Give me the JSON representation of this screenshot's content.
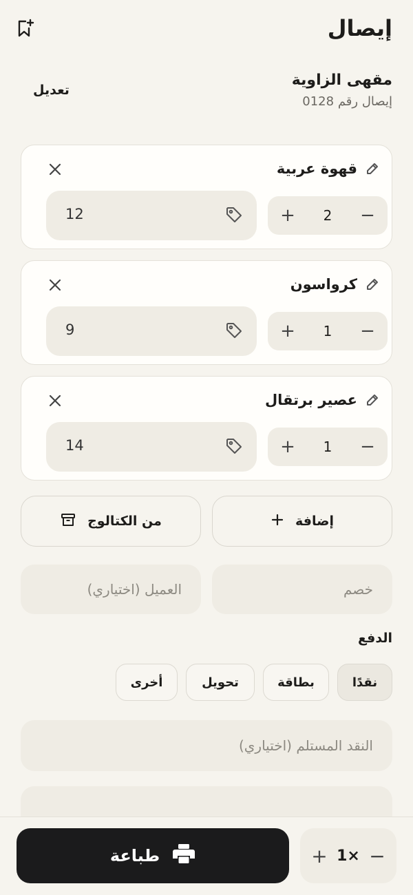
{
  "header": {
    "title": "إيصال",
    "bookmark_icon": "bookmark-plus-icon"
  },
  "shop": {
    "name": "مقهى الزاوية",
    "receipt_number": "إيصال رقم 0128",
    "edit_label": "تعديل"
  },
  "items": [
    {
      "name": "قهوة عربية",
      "price": "12",
      "quantity": "2"
    },
    {
      "name": "كرواسون",
      "price": "9",
      "quantity": "1"
    },
    {
      "name": "عصير برتقال",
      "price": "14",
      "quantity": "1"
    }
  ],
  "actions": {
    "add_label": "إضافة",
    "catalog_label": "من الكتالوج"
  },
  "inputs": {
    "discount_placeholder": "خصم",
    "customer_placeholder": "العميل (اختياري)",
    "cash_received_placeholder": "النقد المستلم (اختياري)"
  },
  "payment": {
    "label": "الدفع",
    "options": [
      "نقدًا",
      "بطاقة",
      "تحويل",
      "أخرى"
    ],
    "selected": "نقدًا"
  },
  "bottom": {
    "print_label": "طباعة",
    "copies": "1×"
  },
  "colors": {
    "background": "#f6f4ee",
    "card": "#fffefb",
    "field": "#efece4",
    "primary_button": "#1b1b1c"
  }
}
